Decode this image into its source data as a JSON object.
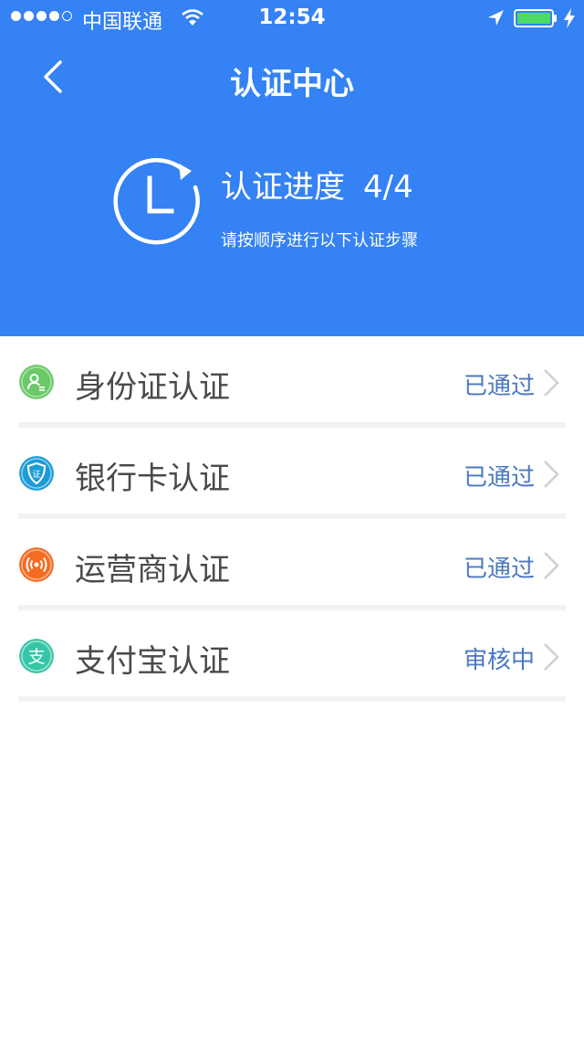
{
  "status_bar": {
    "carrier": "中国联通",
    "time": "12:54"
  },
  "nav": {
    "title": "认证中心"
  },
  "progress": {
    "title": "认证进度",
    "count": "4/4",
    "subtitle": "请按顺序进行以下认证步骤"
  },
  "items": [
    {
      "label": "身份证认证",
      "status": "已通过",
      "icon": "id-card-icon",
      "color": "#6cc96a"
    },
    {
      "label": "银行卡认证",
      "status": "已通过",
      "icon": "shield-icon",
      "color": "#1d9bd7"
    },
    {
      "label": "运营商认证",
      "status": "已通过",
      "icon": "signal-icon",
      "color": "#f46c22"
    },
    {
      "label": "支付宝认证",
      "status": "审核中",
      "icon": "alipay-icon",
      "color": "#37c5a7"
    }
  ],
  "colors": {
    "header_bg": "#3482f4",
    "status_text": "#4a78c2"
  }
}
